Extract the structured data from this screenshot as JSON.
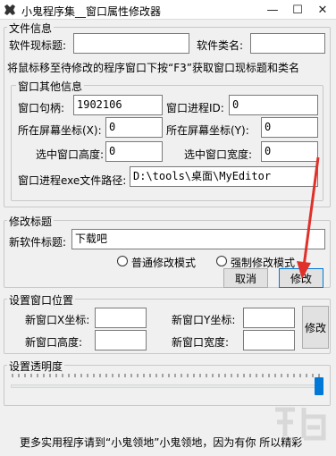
{
  "window": {
    "title": "小鬼程序集__窗口属性修改器",
    "min_glyph": "—",
    "max_glyph": "☐",
    "close_glyph": "✕"
  },
  "file_info": {
    "group_label": "文件信息",
    "title_label": "软件现标题:",
    "title_value": "",
    "class_label": "软件类名:",
    "class_value": "",
    "hint": "将鼠标移至待修改的程序窗口下按“F3”获取窗口现标题和类名"
  },
  "window_info": {
    "group_label": "窗口其他信息",
    "handle_label": "窗口句柄:",
    "handle_value": "1902106",
    "pid_label": "窗口进程ID:",
    "pid_value": "0",
    "x_label": "所在屏幕坐标(X):",
    "x_value": "0",
    "y_label": "所在屏幕坐标(Y):",
    "y_value": "0",
    "height_label": "选中窗口高度:",
    "height_value": "0",
    "width_label": "选中窗口宽度:",
    "width_value": "0",
    "path_label": "窗口进程exe文件路径:",
    "path_value": "D:\\tools\\桌面\\MyEditor"
  },
  "modify_title": {
    "group_label": "修改标题",
    "new_title_label": "新软件标题:",
    "new_title_value": "下载吧",
    "radio_normal": "普通修改模式",
    "radio_force": "强制修改模式",
    "cancel_label": "取消",
    "modify_label": "修改"
  },
  "position": {
    "group_label": "设置窗口位置",
    "new_x_label": "新窗口X坐标:",
    "new_x_value": "",
    "new_y_label": "新窗口Y坐标:",
    "new_y_value": "",
    "new_height_label": "新窗口高度:",
    "new_height_value": "",
    "new_width_label": "新窗口宽度:",
    "new_width_value": "",
    "modify_label": "修改"
  },
  "transparency": {
    "group_label": "设置透明度",
    "level": 1.0
  },
  "footer": {
    "text": "更多实用程序请到“小鬼领地”小鬼领地，因为有你 所以精彩"
  },
  "colors": {
    "annotation_arrow": "#e0302a",
    "slider_thumb": "#0078d7"
  },
  "icons": {
    "app": "app-logo-icon"
  }
}
